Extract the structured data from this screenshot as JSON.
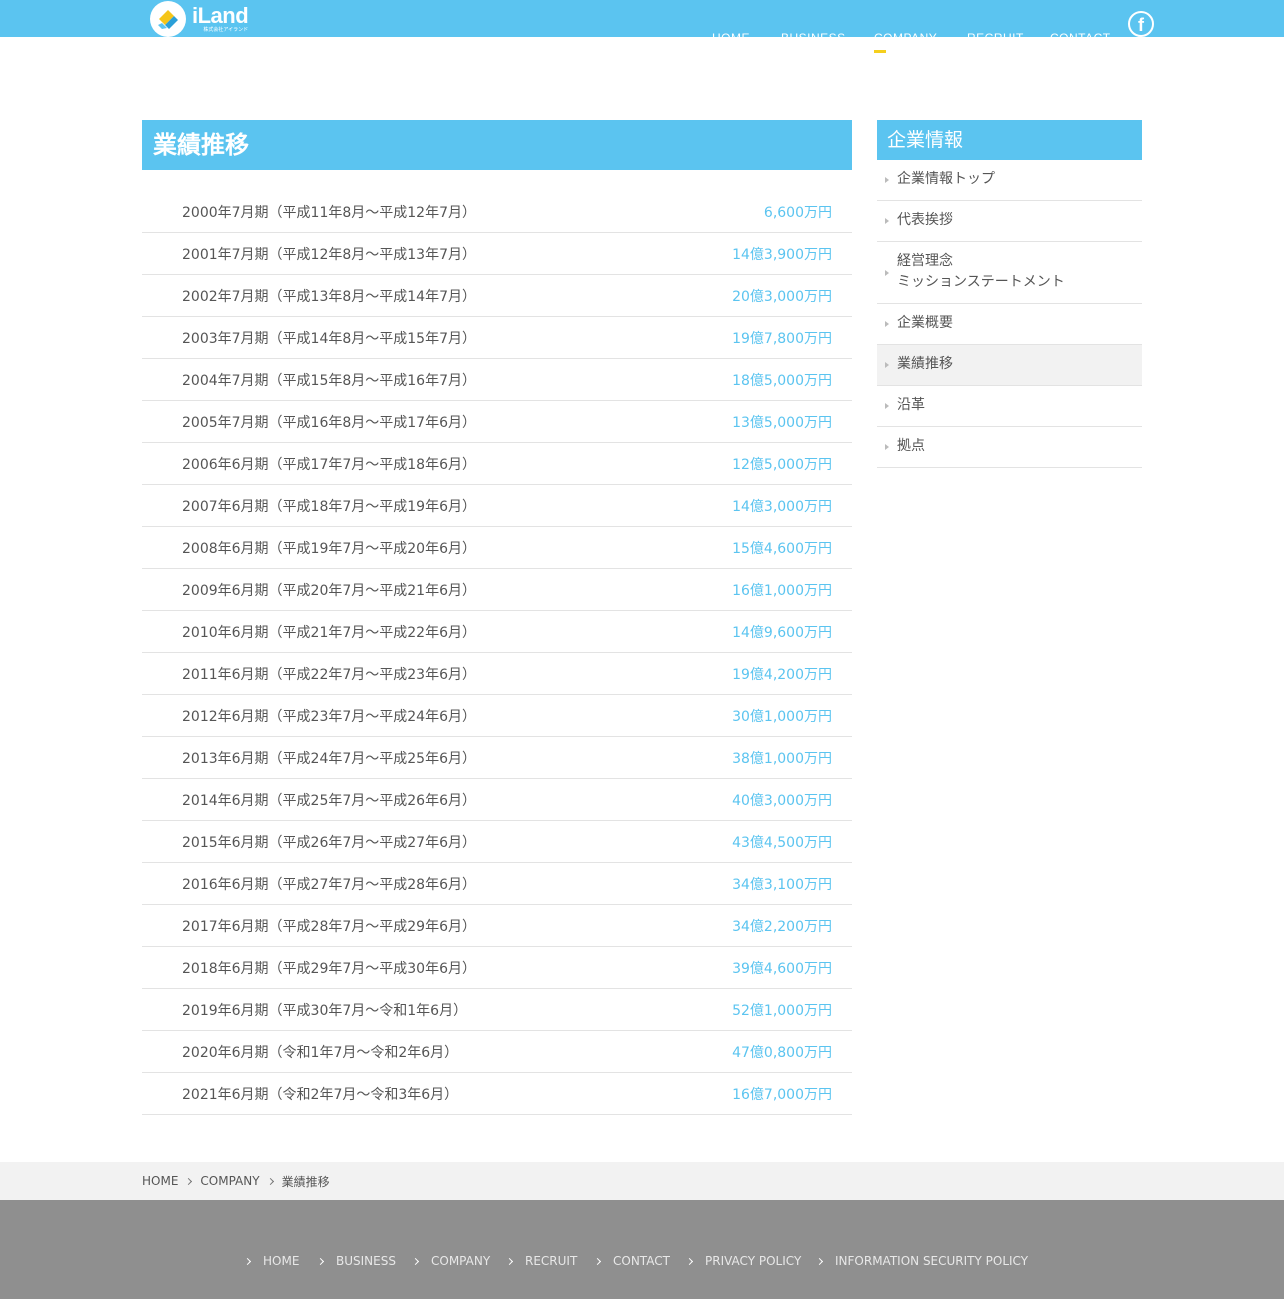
{
  "header": {
    "logo_name": "iLand",
    "logo_sub": "株式会社アイランド",
    "nav": [
      "HOME",
      "BUSINESS",
      "COMPANY",
      "RECRUIT",
      "CONTACT"
    ],
    "active_nav": "COMPANY",
    "facebook_label": "f"
  },
  "main": {
    "title": "業績推移",
    "results": [
      {
        "period": "2000年7月期（平成11年8月～平成12年7月）",
        "amount": "6,600万円"
      },
      {
        "period": "2001年7月期（平成12年8月～平成13年7月）",
        "amount": "14億3,900万円"
      },
      {
        "period": "2002年7月期（平成13年8月～平成14年7月）",
        "amount": "20億3,000万円"
      },
      {
        "period": "2003年7月期（平成14年8月～平成15年7月）",
        "amount": "19億7,800万円"
      },
      {
        "period": "2004年7月期（平成15年8月～平成16年7月）",
        "amount": "18億5,000万円"
      },
      {
        "period": "2005年7月期（平成16年8月～平成17年6月）",
        "amount": "13億5,000万円"
      },
      {
        "period": "2006年6月期（平成17年7月～平成18年6月）",
        "amount": "12億5,000万円"
      },
      {
        "period": "2007年6月期（平成18年7月～平成19年6月）",
        "amount": "14億3,000万円"
      },
      {
        "period": "2008年6月期（平成19年7月～平成20年6月）",
        "amount": "15億4,600万円"
      },
      {
        "period": "2009年6月期（平成20年7月～平成21年6月）",
        "amount": "16億1,000万円"
      },
      {
        "period": "2010年6月期（平成21年7月～平成22年6月）",
        "amount": "14億9,600万円"
      },
      {
        "period": "2011年6月期（平成22年7月～平成23年6月）",
        "amount": "19億4,200万円"
      },
      {
        "period": "2012年6月期（平成23年7月～平成24年6月）",
        "amount": "30億1,000万円"
      },
      {
        "period": "2013年6月期（平成24年7月～平成25年6月）",
        "amount": "38億1,000万円"
      },
      {
        "period": "2014年6月期（平成25年7月～平成26年6月）",
        "amount": "40億3,000万円"
      },
      {
        "period": "2015年6月期（平成26年7月～平成27年6月）",
        "amount": "43億4,500万円"
      },
      {
        "period": "2016年6月期（平成27年7月～平成28年6月）",
        "amount": "34億3,100万円"
      },
      {
        "period": "2017年6月期（平成28年7月～平成29年6月）",
        "amount": "34億2,200万円"
      },
      {
        "period": "2018年6月期（平成29年7月～平成30年6月）",
        "amount": "39億4,600万円"
      },
      {
        "period": "2019年6月期（平成30年7月～令和1年6月）",
        "amount": "52億1,000万円"
      },
      {
        "period": "2020年6月期（令和1年7月～令和2年6月）",
        "amount": "47億0,800万円"
      },
      {
        "period": "2021年6月期（令和2年7月～令和3年6月）",
        "amount": "16億7,000万円"
      }
    ]
  },
  "sidebar": {
    "title": "企業情報",
    "items": [
      {
        "label": "企業情報トップ"
      },
      {
        "label": "代表挨拶"
      },
      {
        "label": "経営理念",
        "label2": "ミッションステートメント"
      },
      {
        "label": "企業概要"
      },
      {
        "label": "業績推移",
        "active": true
      },
      {
        "label": "沿革"
      },
      {
        "label": "拠点"
      }
    ]
  },
  "breadcrumb": [
    "HOME",
    "COMPANY",
    "業績推移"
  ],
  "footer": {
    "links": [
      "HOME",
      "BUSINESS",
      "COMPANY",
      "RECRUIT",
      "CONTACT",
      "PRIVACY POLICY",
      "INFORMATION SECURITY POLICY"
    ]
  },
  "colors": {
    "accent": "#5bc4f0",
    "nav_underline": "#f5cf1d",
    "footer": "#8f8f8f",
    "breadcrumb_bg": "#f2f2f2"
  }
}
